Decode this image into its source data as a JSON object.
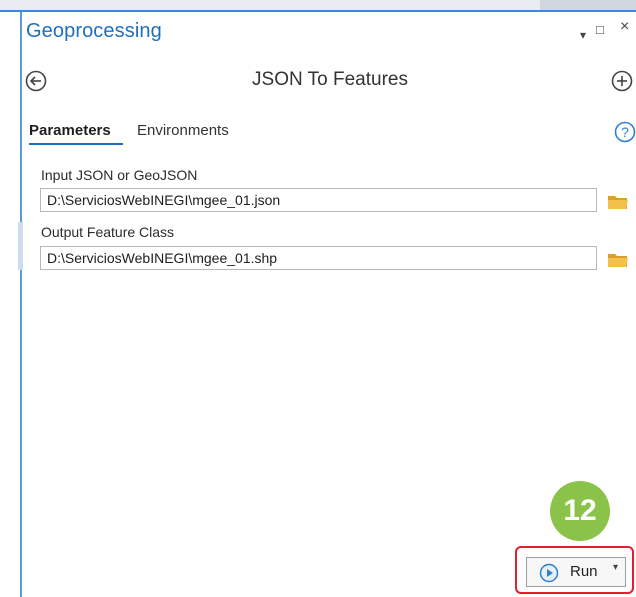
{
  "pane": {
    "title": "Geoprocessing",
    "window_controls": {
      "menu": "▾",
      "maximize": "□",
      "close": "×"
    }
  },
  "tool": {
    "title": "JSON To Features"
  },
  "tabs": [
    {
      "label": "Parameters",
      "active": true
    },
    {
      "label": "Environments",
      "active": false
    }
  ],
  "parameters": {
    "input_json": {
      "label": "Input JSON or GeoJSON",
      "value": "D:\\ServiciosWebINEGI\\mgee_01.json"
    },
    "output_feature_class": {
      "label": "Output Feature Class",
      "value": "D:\\ServiciosWebINEGI\\mgee_01.shp"
    }
  },
  "callout": {
    "step_number": "12"
  },
  "run": {
    "label": "Run",
    "dropdown": "▾"
  },
  "colors": {
    "accent": "#1f6fbf",
    "badge": "#8bc34a",
    "highlight": "#e0202e",
    "folder": "#f2c04b"
  },
  "icons": [
    "back-icon",
    "add-icon",
    "help-icon",
    "folder-icon",
    "play-icon",
    "chevron-down-icon"
  ]
}
